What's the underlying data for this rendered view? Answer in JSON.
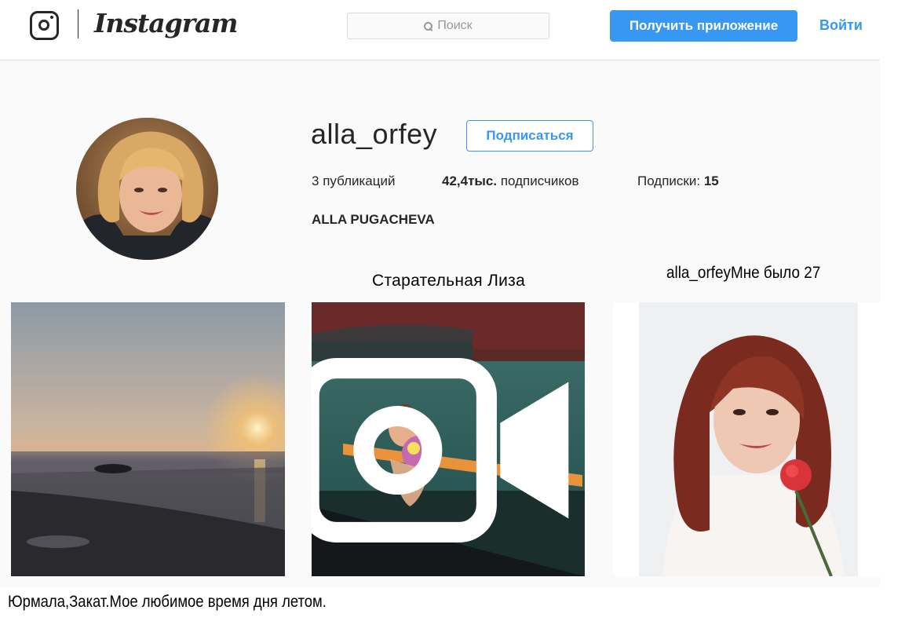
{
  "header": {
    "wordmark": "Instagram",
    "search_placeholder": "Поиск",
    "get_app_label": "Получить приложение",
    "login_label": "Войти"
  },
  "profile": {
    "username": "alla_orfey",
    "follow_label": "Подписаться",
    "posts_count": "3",
    "posts_label": "публикаций",
    "followers_count": "42,4тыс.",
    "followers_label": "подписчиков",
    "following_label": "Подписки:",
    "following_count": "15",
    "full_name": "ALLA PUGACHEVA"
  },
  "posts": [
    {
      "caption": "Юрмала,Закат.Мое любимое время дня летом.",
      "icon": "sunset-photo"
    },
    {
      "caption": "Старательная  Лиза",
      "icon": "video-icon"
    },
    {
      "caption": "alla_orfeyМне было 27",
      "icon": "portrait-photo"
    }
  ],
  "colors": {
    "accent": "#3897f0",
    "text": "#262626",
    "background": "#fafafa",
    "border": "#dbdbdb"
  }
}
